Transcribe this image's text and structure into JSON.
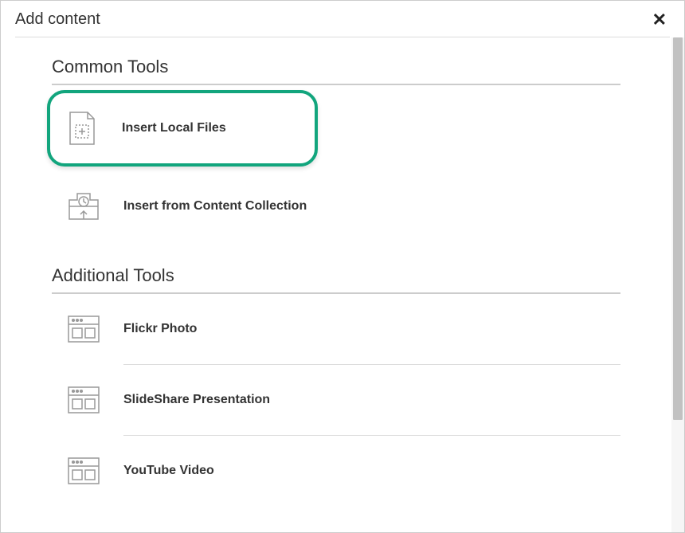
{
  "modal": {
    "title": "Add content",
    "close_label": "✕"
  },
  "sections": {
    "common": {
      "title": "Common Tools",
      "items": {
        "local_files": "Insert Local Files",
        "content_collection": "Insert from Content Collection"
      }
    },
    "additional": {
      "title": "Additional Tools",
      "items": {
        "flickr": "Flickr Photo",
        "slideshare": "SlideShare Presentation",
        "youtube": "YouTube Video"
      }
    }
  }
}
